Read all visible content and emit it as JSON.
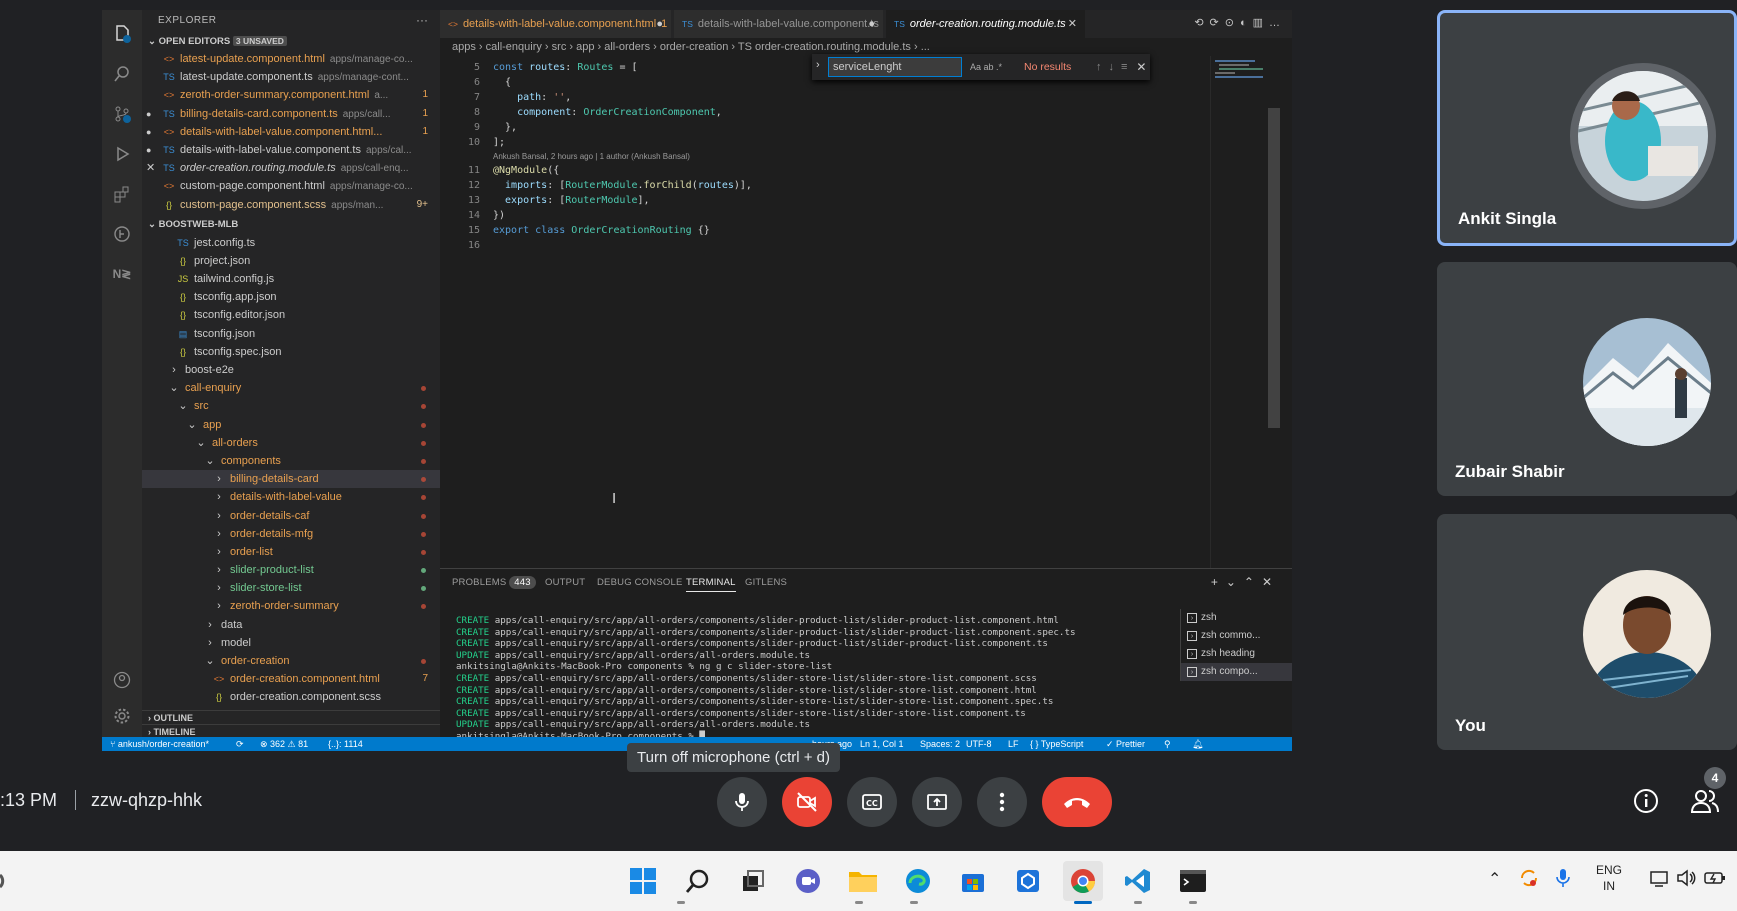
{
  "explorer": {
    "title": "EXPLORER",
    "open_editors_label": "OPEN EDITORS",
    "unsaved_badge": "3 UNSAVED",
    "open_editors": [
      {
        "icon": "<>",
        "name": "latest-update.component.html",
        "desc": "apps/manage-co...",
        "count": "",
        "color": "#e8a050",
        "modified": false,
        "close": false
      },
      {
        "icon": "TS",
        "name": "latest-update.component.ts",
        "desc": "apps/manage-cont...",
        "count": "",
        "color": "#cccccc",
        "modified": false,
        "close": false
      },
      {
        "icon": "<>",
        "name": "zeroth-order-summary.component.html",
        "desc": "a...",
        "count": "1",
        "color": "#e8a050",
        "modified": false,
        "close": false
      },
      {
        "icon": "TS",
        "name": "billing-details-card.component.ts",
        "desc": "apps/call...",
        "count": "1",
        "color": "#e8a050",
        "modified": true,
        "close": false
      },
      {
        "icon": "<>",
        "name": "details-with-label-value.component.html...",
        "desc": "",
        "count": "1",
        "color": "#e8a050",
        "modified": true,
        "close": false
      },
      {
        "icon": "TS",
        "name": "details-with-label-value.component.ts",
        "desc": "apps/cal...",
        "count": "",
        "color": "#cccccc",
        "modified": true,
        "close": false
      },
      {
        "icon": "TS",
        "name": "order-creation.routing.module.ts",
        "desc": "apps/call-enq...",
        "count": "",
        "color": "#cccccc",
        "modified": false,
        "close": true
      },
      {
        "icon": "<>",
        "name": "custom-page.component.html",
        "desc": "apps/manage-co...",
        "count": "",
        "color": "#cccccc",
        "modified": false,
        "close": false
      },
      {
        "icon": "{}",
        "name": "custom-page.component.scss",
        "desc": "apps/man...",
        "count": "9+",
        "color": "#e2c08d",
        "modified": false,
        "close": false
      }
    ],
    "workspace_label": "BOOSTWEB-MLB",
    "tree": [
      {
        "indent": 0,
        "icon": "TS",
        "name": "jest.config.ts",
        "color": "#cccccc",
        "dot": ""
      },
      {
        "indent": 0,
        "icon": "{}",
        "name": "project.json",
        "color": "#cccccc",
        "dot": ""
      },
      {
        "indent": 0,
        "icon": "JS",
        "name": "tailwind.config.js",
        "color": "#cccccc",
        "dot": ""
      },
      {
        "indent": 0,
        "icon": "{}",
        "name": "tsconfig.app.json",
        "color": "#cccccc",
        "dot": ""
      },
      {
        "indent": 0,
        "icon": "{}",
        "name": "tsconfig.editor.json",
        "color": "#cccccc",
        "dot": ""
      },
      {
        "indent": 0,
        "icon": "▤",
        "name": "tsconfig.json",
        "color": "#cccccc",
        "dot": ""
      },
      {
        "indent": 0,
        "icon": "{}",
        "name": "tsconfig.spec.json",
        "color": "#cccccc",
        "dot": ""
      },
      {
        "indent": -1,
        "icon": "›",
        "name": "boost-e2e",
        "color": "#cccccc",
        "dot": ""
      },
      {
        "indent": -1,
        "icon": "⌄",
        "name": "call-enquiry",
        "color": "#e8a050",
        "dot": "#c74e39"
      },
      {
        "indent": 0,
        "icon": "⌄",
        "name": "src",
        "color": "#e8a050",
        "dot": "#c74e39"
      },
      {
        "indent": 1,
        "icon": "⌄",
        "name": "app",
        "color": "#e8a050",
        "dot": "#c74e39"
      },
      {
        "indent": 2,
        "icon": "⌄",
        "name": "all-orders",
        "color": "#e8a050",
        "dot": "#c74e39"
      },
      {
        "indent": 3,
        "icon": "⌄",
        "name": "components",
        "color": "#e8a050",
        "dot": "#c74e39"
      },
      {
        "indent": 4,
        "icon": "›",
        "name": "billing-details-card",
        "color": "#e8a050",
        "dot": "#c74e39",
        "sel": true
      },
      {
        "indent": 4,
        "icon": "›",
        "name": "details-with-label-value",
        "color": "#e8a050",
        "dot": "#c74e39"
      },
      {
        "indent": 4,
        "icon": "›",
        "name": "order-details-caf",
        "color": "#e8a050",
        "dot": "#c74e39"
      },
      {
        "indent": 4,
        "icon": "›",
        "name": "order-details-mfg",
        "color": "#e8a050",
        "dot": "#c74e39"
      },
      {
        "indent": 4,
        "icon": "›",
        "name": "order-list",
        "color": "#e8a050",
        "dot": "#c74e39"
      },
      {
        "indent": 4,
        "icon": "›",
        "name": "slider-product-list",
        "color": "#73c991",
        "dot": "#73c991"
      },
      {
        "indent": 4,
        "icon": "›",
        "name": "slider-store-list",
        "color": "#73c991",
        "dot": "#73c991"
      },
      {
        "indent": 4,
        "icon": "›",
        "name": "zeroth-order-summary",
        "color": "#e8a050",
        "dot": "#c74e39"
      },
      {
        "indent": 3,
        "icon": "›",
        "name": "data",
        "color": "#cccccc",
        "dot": ""
      },
      {
        "indent": 3,
        "icon": "›",
        "name": "model",
        "color": "#cccccc",
        "dot": ""
      },
      {
        "indent": 3,
        "icon": "⌄",
        "name": "order-creation",
        "color": "#e8a050",
        "dot": "#c74e39"
      },
      {
        "indent": 4,
        "icon": "<>",
        "name": "order-creation.component.html",
        "color": "#e8a050",
        "dot": "",
        "count": "7"
      },
      {
        "indent": 4,
        "icon": "{}",
        "name": "order-creation.component.scss",
        "color": "#cccccc",
        "dot": ""
      }
    ],
    "outline_label": "OUTLINE",
    "timeline_label": "TIMELINE"
  },
  "tabs": [
    {
      "icon": "<>",
      "label": "details-with-label-value.component.html",
      "badge": "1",
      "modified": true,
      "active": false
    },
    {
      "icon": "TS",
      "label": "details-with-label-value.component.ts",
      "badge": "",
      "modified": true,
      "active": false
    },
    {
      "icon": "TS",
      "label": "order-creation.routing.module.ts",
      "badge": "",
      "modified": false,
      "active": true
    }
  ],
  "breadcrumb": "apps › call-enquiry › src › app › all-orders › order-creation › TS order-creation.routing.module.ts › ...",
  "find": {
    "value": "serviceLenght",
    "options": "Aa  ab  .*",
    "result": "No results"
  },
  "blame": "Ankush Bansal, 2 hours ago | 1 author (Ankush Bansal)",
  "code_lines": [
    {
      "n": "5",
      "html": "<span class='kw'>const</span> <span class='pr'>routes</span><span class='pu'>: </span><span class='ty'>Routes</span><span class='pu'> = [</span>"
    },
    {
      "n": "6",
      "html": "<span class='pu'>  {</span>"
    },
    {
      "n": "7",
      "html": "<span class='pr'>    path</span><span class='pu'>: </span><span class='st'>''</span><span class='pu'>,</span>"
    },
    {
      "n": "8",
      "html": "<span class='pr'>    component</span><span class='pu'>: </span><span class='ty'>OrderCreationComponent</span><span class='pu'>,</span>"
    },
    {
      "n": "9",
      "html": "<span class='pu'>  },</span>"
    },
    {
      "n": "10",
      "html": "<span class='pu'>];</span>"
    },
    {
      "n": "11",
      "html": "<span class='dc'>@NgModule</span><span class='pu'>({</span>"
    },
    {
      "n": "12",
      "html": "<span class='pr'>  imports</span><span class='pu'>: [</span><span class='ty'>RouterModule</span><span class='pu'>.</span><span class='fn'>forChild</span><span class='pu'>(</span><span class='pr'>routes</span><span class='pu'>)],</span>"
    },
    {
      "n": "13",
      "html": "<span class='pr'>  exports</span><span class='pu'>: [</span><span class='ty'>RouterModule</span><span class='pu'>],</span>"
    },
    {
      "n": "14",
      "html": "<span class='pu'>})</span>"
    },
    {
      "n": "15",
      "html": "<span class='kw'>export</span> <span class='kw'>class</span> <span class='ty'>OrderCreationRouting</span><span class='pu'> {}</span>"
    },
    {
      "n": "16",
      "html": ""
    }
  ],
  "panel_tabs": {
    "problems": "PROBLEMS",
    "problems_count": "443",
    "output": "OUTPUT",
    "debug": "DEBUG CONSOLE",
    "terminal": "TERMINAL",
    "gitlens": "GITLENS"
  },
  "terminal_lines": [
    {
      "k": "CREATE",
      "t": " apps/call-enquiry/src/app/all-orders/components/slider-product-list/slider-product-list.component.html"
    },
    {
      "k": "CREATE",
      "t": " apps/call-enquiry/src/app/all-orders/components/slider-product-list/slider-product-list.component.spec.ts"
    },
    {
      "k": "CREATE",
      "t": " apps/call-enquiry/src/app/all-orders/components/slider-product-list/slider-product-list.component.ts"
    },
    {
      "k": "UPDATE",
      "t": " apps/call-enquiry/src/app/all-orders/all-orders.module.ts"
    },
    {
      "k": "",
      "t": "ankitsingla@Ankits-MacBook-Pro components % ng g c slider-store-list"
    },
    {
      "k": "CREATE",
      "t": " apps/call-enquiry/src/app/all-orders/components/slider-store-list/slider-store-list.component.scss"
    },
    {
      "k": "CREATE",
      "t": " apps/call-enquiry/src/app/all-orders/components/slider-store-list/slider-store-list.component.html"
    },
    {
      "k": "CREATE",
      "t": " apps/call-enquiry/src/app/all-orders/components/slider-store-list/slider-store-list.component.spec.ts"
    },
    {
      "k": "CREATE",
      "t": " apps/call-enquiry/src/app/all-orders/components/slider-store-list/slider-store-list.component.ts"
    },
    {
      "k": "UPDATE",
      "t": " apps/call-enquiry/src/app/all-orders/all-orders.module.ts"
    },
    {
      "k": "",
      "t": "ankitsingla@Ankits-MacBook-Pro components % █"
    }
  ],
  "terminal_list": [
    {
      "label": "zsh",
      "sel": false
    },
    {
      "label": "zsh commo...",
      "sel": false
    },
    {
      "label": "zsh heading",
      "sel": false
    },
    {
      "label": "zsh compo...",
      "sel": true
    }
  ],
  "status": {
    "branch": "ankush/order-creation*",
    "errors": "⊗ 362 ⚠ 81",
    "braces": "{..}: 1114",
    "blame": "hours ago",
    "cursor": "Ln 1, Col 1",
    "spaces": "Spaces: 2",
    "encoding": "UTF-8",
    "eol": "LF",
    "lang": "{ } TypeScript",
    "prettier": "✓ Prettier"
  },
  "participants": [
    {
      "name": "Ankit Singla",
      "active": true
    },
    {
      "name": "Zubair Shabir",
      "active": false
    },
    {
      "name": "You",
      "active": false
    }
  ],
  "meeting": {
    "time": ":13 PM",
    "code": "zzw-qhzp-hhk",
    "tooltip": "Turn off microphone (ctrl + d)",
    "people_count": "4"
  },
  "taskbar": {
    "lang": "ENG",
    "region": "IN"
  },
  "colors": {
    "accent": "#8ab4f8",
    "end_call": "#ea4335",
    "vscode_status": "#007acc"
  }
}
